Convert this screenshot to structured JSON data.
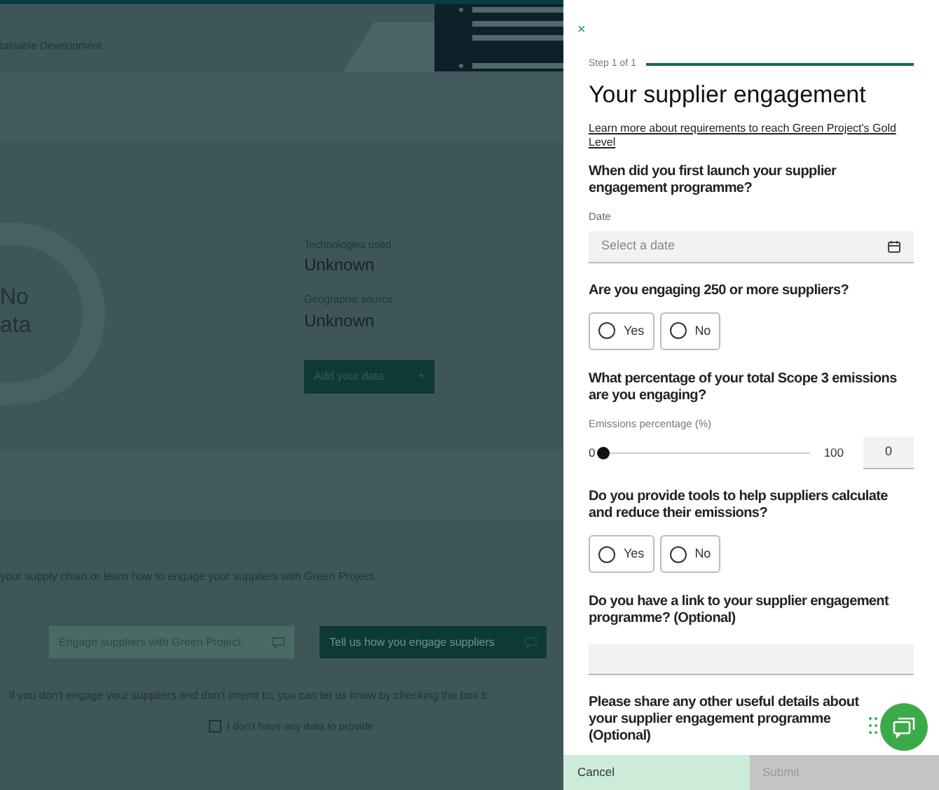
{
  "background": {
    "header_text": "tainable Development",
    "donut_label": [
      "No",
      "ata"
    ],
    "facts": [
      {
        "label": "Technologies used",
        "value": "Unknown"
      },
      {
        "label": "Geographic source",
        "value": "Unknown"
      }
    ],
    "add_button": "Add your data",
    "add_icon": "+",
    "intro": "your supply chain or learn how to engage your suppliers with Green Project.",
    "buttons": [
      {
        "label": "Engage suppliers with Green Project",
        "kind": "light"
      },
      {
        "label": "Tell us how you engage suppliers",
        "kind": "dark"
      }
    ],
    "note": "If you don't engage your suppliers and don't intend to, you can let us know by checking the box b",
    "no_data": {
      "label": "I don't have any data to provide",
      "checked": false
    }
  },
  "drawer": {
    "close": "×",
    "step": "Step 1 of 1",
    "progress": {
      "level": 1
    },
    "title": "Your supplier engagement",
    "link": "Learn more about requirements to reach Green Project's Gold Level",
    "questions": [
      {
        "kind": "date",
        "question": "When did you first launch your supplier engagement programme?",
        "label": "Date",
        "placeholder": "Select a date"
      },
      {
        "kind": "radio",
        "question": "Are you engaging 250 or more suppliers?",
        "options": [
          {
            "label": "Yes",
            "selected": false
          },
          {
            "label": "No",
            "selected": false
          }
        ]
      },
      {
        "kind": "slider",
        "question": "What percentage of your total Scope 3 emissions are you engaging?",
        "label": "Emissions percentage (%)",
        "min": "0",
        "max": "100",
        "level": 0,
        "value": "0"
      },
      {
        "kind": "radio",
        "question": "Do you provide tools to help suppliers calculate and reduce their emissions?",
        "options": [
          {
            "label": "Yes",
            "selected": false
          },
          {
            "label": "No",
            "selected": false
          }
        ]
      },
      {
        "kind": "text",
        "question": "Do you have a link to your supplier engagement programme? (Optional)"
      },
      {
        "kind": "textarea",
        "question": "Please share any other useful details about your supplier engagement programme (Optional)"
      }
    ],
    "cancel": "Cancel",
    "submit": "Submit"
  }
}
